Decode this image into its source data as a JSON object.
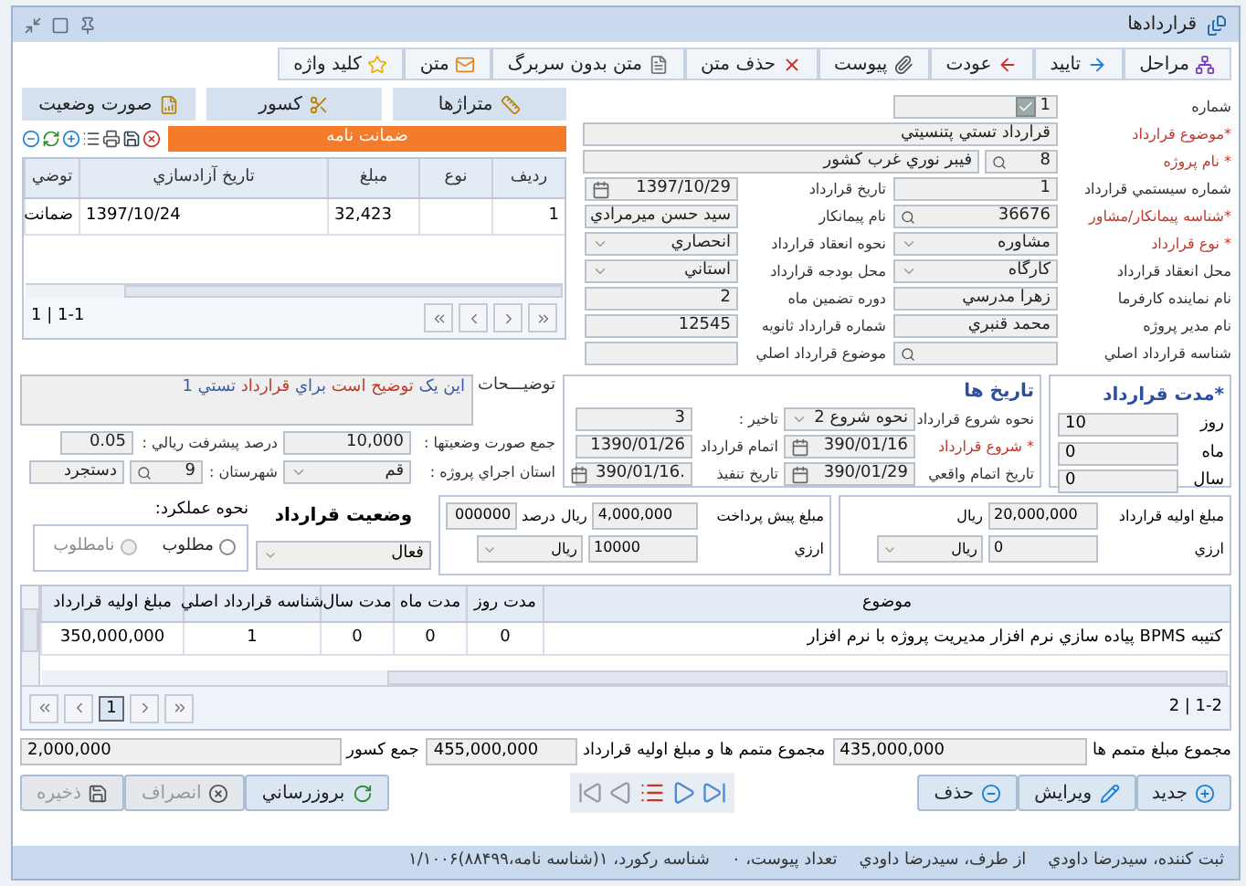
{
  "window": {
    "title": "قراردادها"
  },
  "toolbar": [
    {
      "label": "مراحل"
    },
    {
      "label": "تاييد"
    },
    {
      "label": "عودت"
    },
    {
      "label": "پيوست"
    },
    {
      "label": "حذف متن"
    },
    {
      "label": "متن بدون سربرگ"
    },
    {
      "label": "متن"
    },
    {
      "label": "کليد واژه"
    }
  ],
  "side_buttons": [
    {
      "label": "متراژها"
    },
    {
      "label": "کسور"
    },
    {
      "label": "صورت وضعيت"
    }
  ],
  "guarantee": {
    "title": "ضمانت نامه",
    "columns": [
      "رديف",
      "نوع",
      "مبلغ",
      "تاريخ آزادسازي",
      "توضي"
    ],
    "rows": [
      [
        "1",
        "",
        "32,423",
        "1397/10/24",
        "ضمانت"
      ]
    ],
    "pager": "1 | 1-1"
  },
  "form_rows": [
    [
      {
        "label": "شماره",
        "value": "1",
        "kind": "check",
        "checked": true,
        "required": false
      }
    ],
    [
      {
        "label": "*موضوع قرارداد",
        "value": "قرارداد تستي پتنسيتي",
        "kind": "wide",
        "required": true
      }
    ],
    [
      {
        "label": "* نام پروژه",
        "value": "8",
        "detail": "فيبر نوري غرب کشور",
        "kind": "search",
        "required": true
      }
    ],
    [
      {
        "label": "شماره سيستمي قرارداد",
        "value": "1",
        "kind": "text",
        "required": false
      },
      {
        "label": "تاريخ قرارداد",
        "value": "1397/10/29",
        "kind": "date",
        "required": false
      }
    ],
    [
      {
        "label": "*شناسه پيمانکار/مشاور",
        "value": "36676",
        "kind": "search",
        "required": true
      },
      {
        "label": "نام پيمانکار",
        "value": "سيد حسن ميرمرادي",
        "kind": "text",
        "required": false
      }
    ],
    [
      {
        "label": "* نوع قرارداد",
        "value": "مشاوره",
        "kind": "select",
        "required": true
      },
      {
        "label": "نحوه انعقاد قرارداد",
        "value": "انحصاري",
        "kind": "select",
        "required": false
      }
    ],
    [
      {
        "label": "محل انعقاد قرارداد",
        "value": "کارگاه",
        "kind": "select",
        "required": false
      },
      {
        "label": "محل بودجه قرارداد",
        "value": "استاني",
        "kind": "select",
        "required": false
      }
    ],
    [
      {
        "label": "نام نماينده کارفرما",
        "value": "زهرا مدرسي",
        "kind": "text",
        "required": false
      },
      {
        "label": "دوره تضمين ماه",
        "value": "2",
        "kind": "text",
        "required": false
      }
    ],
    [
      {
        "label": "نام مدير پروژه",
        "value": "محمد قنبري",
        "kind": "text",
        "required": false
      },
      {
        "label": "شماره قرارداد ثانويه",
        "value": "12545",
        "kind": "text",
        "required": false
      }
    ],
    [
      {
        "label": "شناسه قرارداد اصلي",
        "kind": "search",
        "required": false
      },
      {
        "label": "موضوع قرارداد اصلي",
        "kind": "text",
        "required": false
      }
    ]
  ],
  "duration": {
    "title": "*مدت قرارداد",
    "fields": [
      {
        "label": "روز",
        "value": "10"
      },
      {
        "label": "ماه",
        "value": "0"
      },
      {
        "label": "سال",
        "value": "0"
      }
    ]
  },
  "dates": {
    "title": "تاريخ ها",
    "rows": [
      [
        {
          "label": "نحوه شروع قرارداد",
          "value": "نحوه شروع 2",
          "kind": "select",
          "required": false
        },
        {
          "label": "تاخير :",
          "value": "3",
          "kind": "text",
          "required": false
        }
      ],
      [
        {
          "label": "* شروع قرارداد",
          "value": "390/01/16",
          "kind": "date",
          "required": true
        },
        {
          "label": "اتمام قرارداد",
          "value": "1390/01/26",
          "kind": "text",
          "required": false
        }
      ],
      [
        {
          "label": "تاريخ اتمام واقعي",
          "value": "390/01/29",
          "kind": "date",
          "required": false
        },
        {
          "label": "تاريخ تنفيذ",
          "value": ".390/01/16",
          "kind": "date",
          "required": false
        }
      ]
    ]
  },
  "description": {
    "label": "توضيـــحات",
    "segments": [
      {
        "text": "اين يک",
        "color": "#3b5ca8"
      },
      {
        "text": "توضيح است",
        "color": "#c0392b"
      },
      {
        "text": "براي",
        "color": "#3b5ca8"
      },
      {
        "text": "قرارداد",
        "color": "#c0392b"
      },
      {
        "text": "تستي 1",
        "color": "#3b5ca8"
      }
    ]
  },
  "progress_rows": [
    [
      {
        "label": "جمع صورت وضعيتها :",
        "value": "10,000",
        "kind": "text",
        "required": false
      },
      {
        "label": "درصد پيشرفت ريالي :",
        "value": "0.05",
        "kind": "text",
        "required": false
      }
    ],
    [
      {
        "label": "استان اجراي پروژه :",
        "value": "قم",
        "kind": "select",
        "required": false
      },
      {
        "label": "شهرستان :",
        "value": "9",
        "detail": "دستجرد",
        "kind": "search",
        "required": false
      }
    ]
  ],
  "initial_amount": {
    "label": "مبلغ اوليه قرارداد",
    "value": "20,000,000",
    "unit": "ريال",
    "fx_label": "ارزي",
    "fx_value": "0",
    "fx_currency": "ريال"
  },
  "prepayment": {
    "label": "مبلغ پيش پرداخت",
    "value": "4,000,000",
    "unit": "ريال",
    "percent_label": "درصد",
    "percent": "000000",
    "fx_label": "ارزي",
    "fx_value": "10000",
    "fx_currency": "ريال"
  },
  "status": {
    "label": "وضعيت قرارداد",
    "value": "فعال"
  },
  "performance": {
    "label": "نحوه عملکرد:",
    "options": [
      {
        "label": "مطلوب",
        "selected": false,
        "disabled": false
      },
      {
        "label": "نامطلوب",
        "selected": false,
        "disabled": true
      }
    ]
  },
  "amendments": {
    "columns": [
      "موضوع",
      "مدت روز",
      "مدت ماه",
      "مدت سال",
      "شناسه قرارداد اصلي",
      "مبلغ اوليه قرارداد"
    ],
    "rows": [
      [
        "کتيبه BPMS پياده سازي نرم افزار مديريت پروژه با نرم افزار",
        "0",
        "0",
        "0",
        "1",
        "350,000,000"
      ]
    ],
    "page": "1",
    "pager": "2 | 1-2"
  },
  "totals": [
    {
      "label": "مجموع مبلغ متمم ها",
      "value": "435,000,000"
    },
    {
      "label": "مجموع متمم ها و مبلغ اوليه قرارداد",
      "value": "455,000,000"
    },
    {
      "label": "جمع کسور",
      "value": "2,000,000"
    }
  ],
  "record_buttons": [
    {
      "label": "جديد",
      "disabled": false
    },
    {
      "label": "ويرايش",
      "disabled": false
    },
    {
      "label": "حذف",
      "disabled": false
    }
  ],
  "form_buttons": [
    {
      "label": "بروزرساني",
      "disabled": false
    },
    {
      "label": "انصراف",
      "disabled": true
    },
    {
      "label": "ذخيره",
      "disabled": true
    }
  ],
  "status_bar": [
    "ثبت کننده، سيدرضا داودي",
    "از طرف، سيدرضا داودي",
    "تعداد پيوست، ۰",
    "شناسه رکورد، ۱(شناسه نامه،۸۸۴۹۹)۱/۱۰۰۶"
  ]
}
